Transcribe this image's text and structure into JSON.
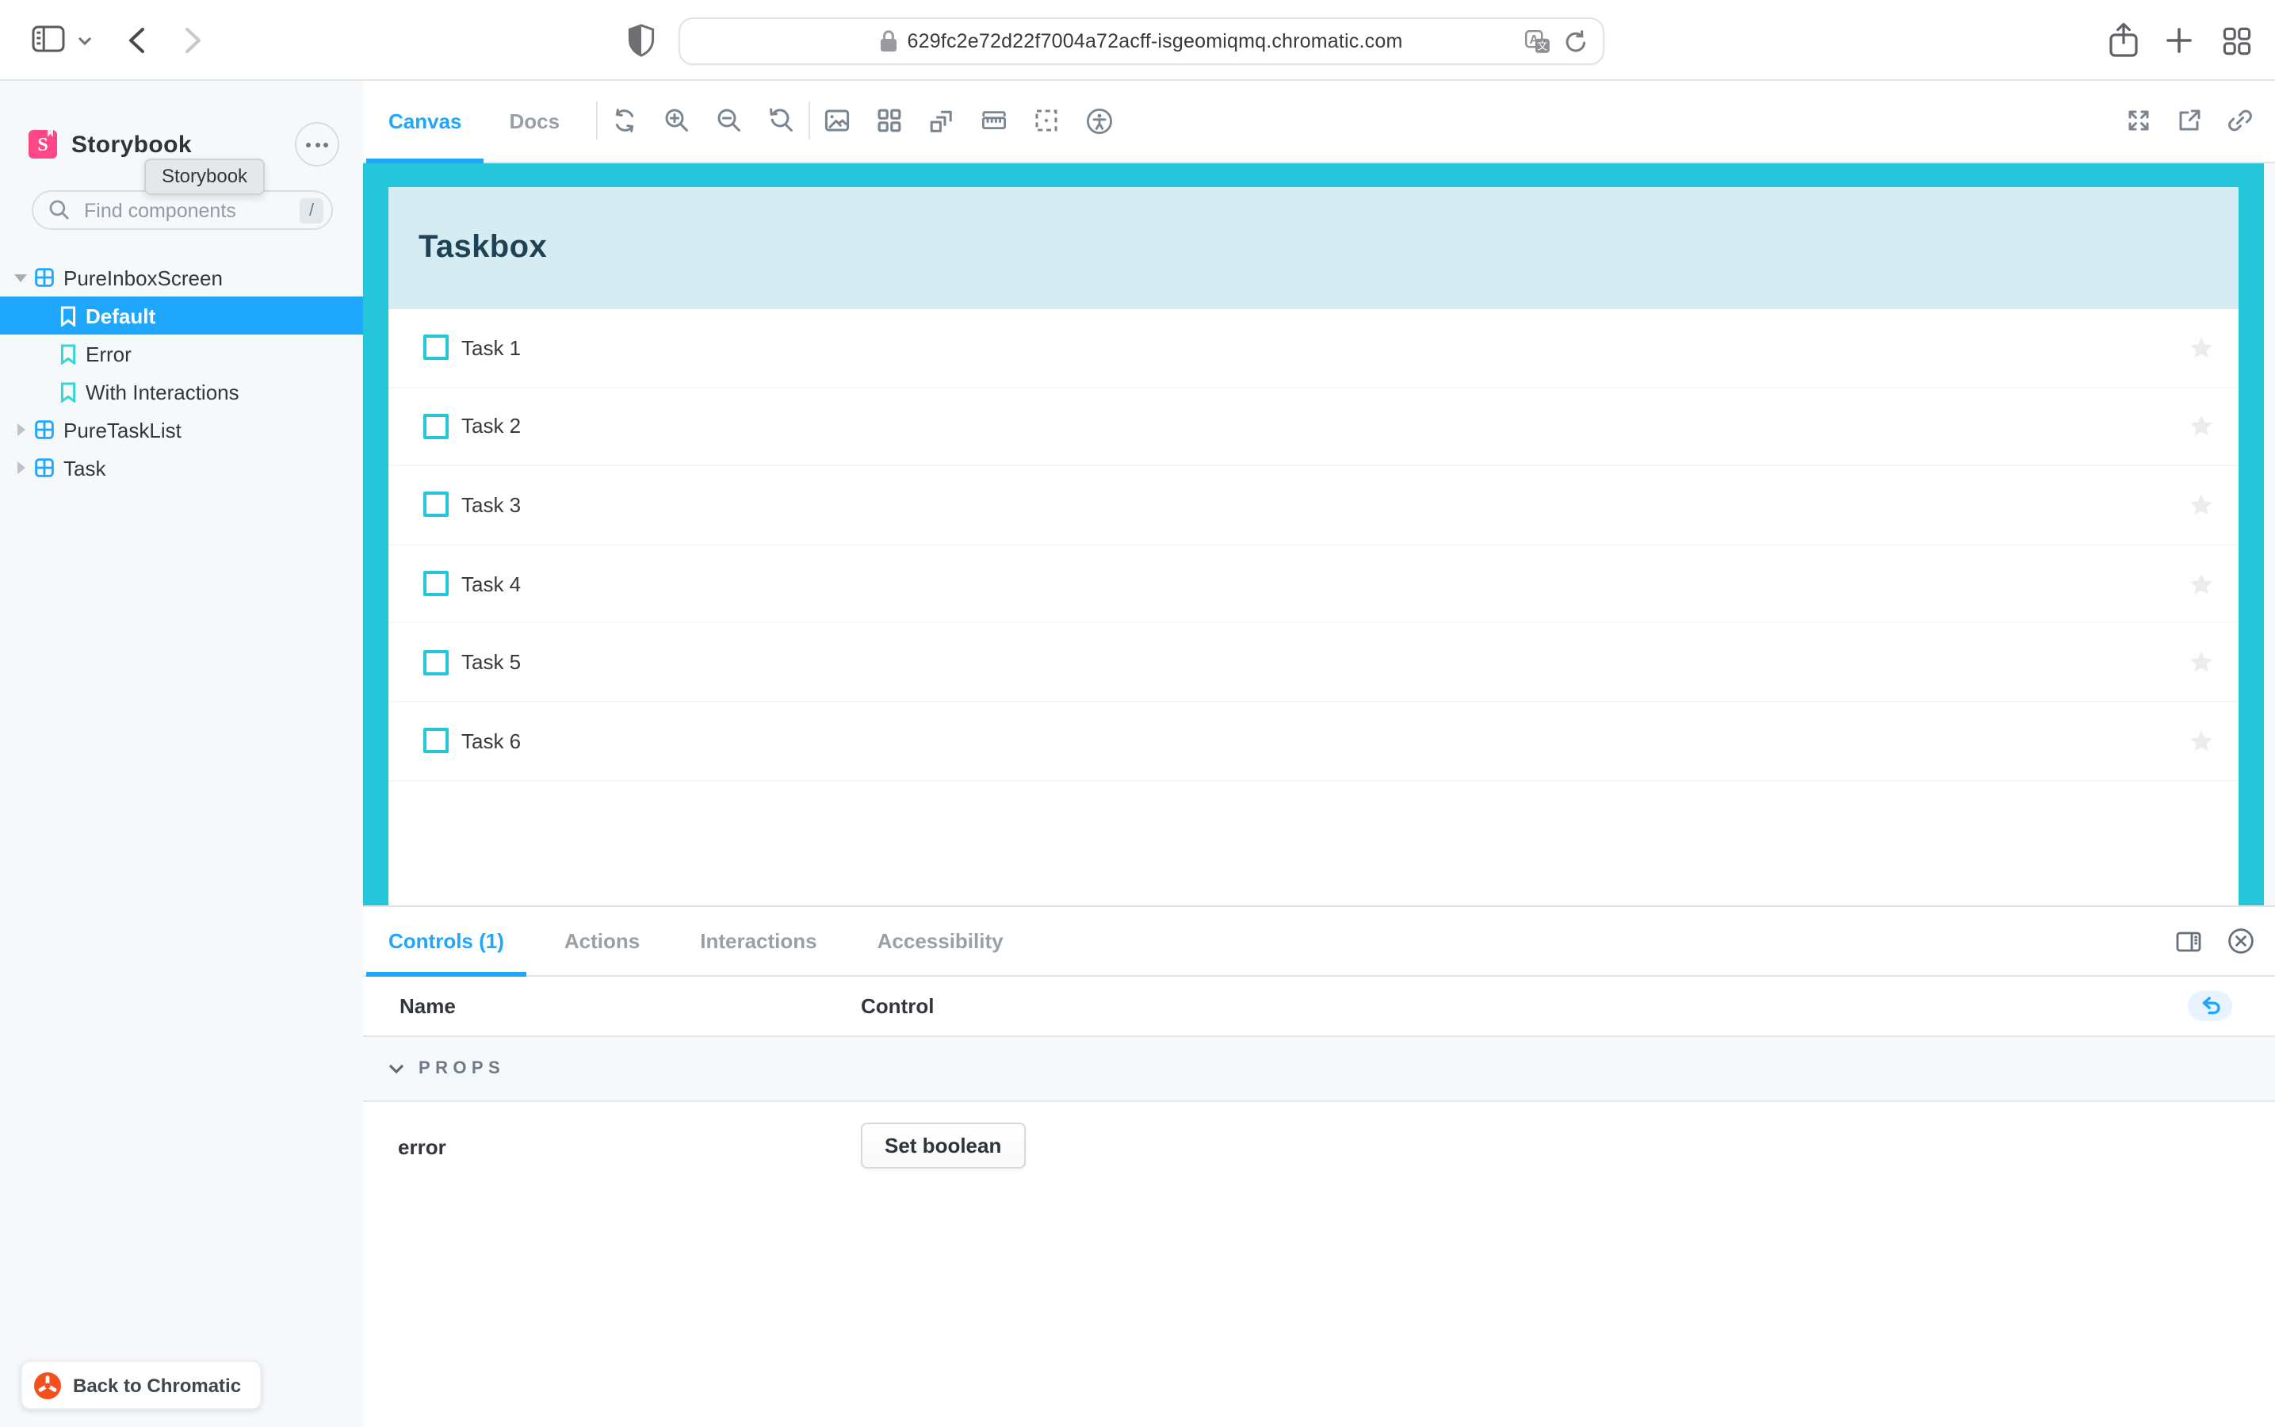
{
  "browser": {
    "url": "629fc2e72d22f7004a72acff-isgeomiqmq.chromatic.com"
  },
  "sidebar": {
    "brand": "Storybook",
    "tooltip": "Storybook",
    "search": {
      "placeholder": "Find components",
      "shortcut": "/"
    },
    "tree": {
      "components": [
        {
          "label": "PureInboxScreen",
          "expanded": true,
          "stories": [
            {
              "label": "Default",
              "selected": true
            },
            {
              "label": "Error",
              "selected": false
            },
            {
              "label": "With Interactions",
              "selected": false
            }
          ]
        },
        {
          "label": "PureTaskList",
          "expanded": false
        },
        {
          "label": "Task",
          "expanded": false
        }
      ]
    },
    "back_button_label": "Back to Chromatic"
  },
  "canvas": {
    "tabs": [
      {
        "label": "Canvas",
        "active": true
      },
      {
        "label": "Docs",
        "active": false
      }
    ],
    "preview": {
      "app_title": "Taskbox",
      "tasks": [
        "Task 1",
        "Task 2",
        "Task 3",
        "Task 4",
        "Task 5",
        "Task 6"
      ]
    }
  },
  "panel": {
    "tabs": [
      {
        "label": "Controls (1)",
        "active": true
      },
      {
        "label": "Actions",
        "active": false
      },
      {
        "label": "Interactions",
        "active": false
      },
      {
        "label": "Accessibility",
        "active": false
      }
    ],
    "columns": {
      "name": "Name",
      "control": "Control"
    },
    "section_label": "PROPS",
    "controls": [
      {
        "name": "error",
        "control_label": "Set boolean"
      }
    ]
  },
  "colors": {
    "accent_blue": "#1EA7FD",
    "preview_cyan": "#26C6DA",
    "taskbox_header_bg": "#D5ECF3",
    "taskbox_title": "#1F4254",
    "brand_pink": "#FF4785",
    "story_icon_teal": "#37D5D3",
    "chromatic_orange": "#F4501E",
    "sidebar_bg": "#F6F9FC"
  }
}
